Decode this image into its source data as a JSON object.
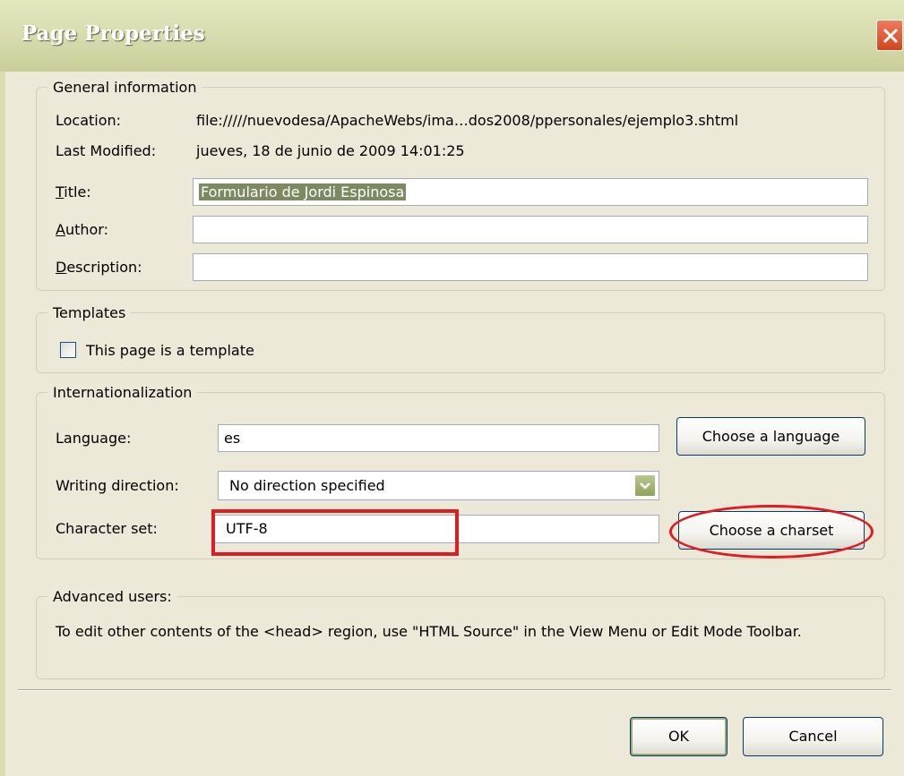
{
  "window": {
    "title": "Page Properties",
    "close_icon": "close-icon"
  },
  "general": {
    "legend": "General information",
    "location_label": "Location:",
    "location_value": "file://///nuevodesa/ApacheWebs/ima…dos2008/ppersonales/ejemplo3.shtml",
    "modified_label": "Last Modified:",
    "modified_value": "jueves, 18 de junio de 2009 14:01:25",
    "title_label_key": "T",
    "title_label_rest": "itle:",
    "title_value": "Formulario de Jordi Espinosa",
    "author_label_key": "A",
    "author_label_rest": "uthor:",
    "author_value": "",
    "description_label_key": "D",
    "description_label_rest": "escription:",
    "description_value": ""
  },
  "templates": {
    "legend": "Templates",
    "checkbox_label": "This page is a template",
    "checked": false
  },
  "intl": {
    "legend": "Internationalization",
    "language_label": "Language:",
    "language_value": "es",
    "choose_language": "Choose a language",
    "direction_label": "Writing direction:",
    "direction_value": "No direction specified",
    "charset_label": "Character set:",
    "charset_value": "UTF-8",
    "choose_charset": "Choose a charset"
  },
  "advanced": {
    "legend": "Advanced users:",
    "text": "To edit other contents of the <head> region, use \"HTML Source\" in the View Menu or Edit Mode Toolbar."
  },
  "buttons": {
    "ok": "OK",
    "cancel": "Cancel"
  },
  "colors": {
    "annotation_red": "#e11b22",
    "title_bar": "#d9ddb0",
    "dialog_bg": "#ece9d8"
  }
}
